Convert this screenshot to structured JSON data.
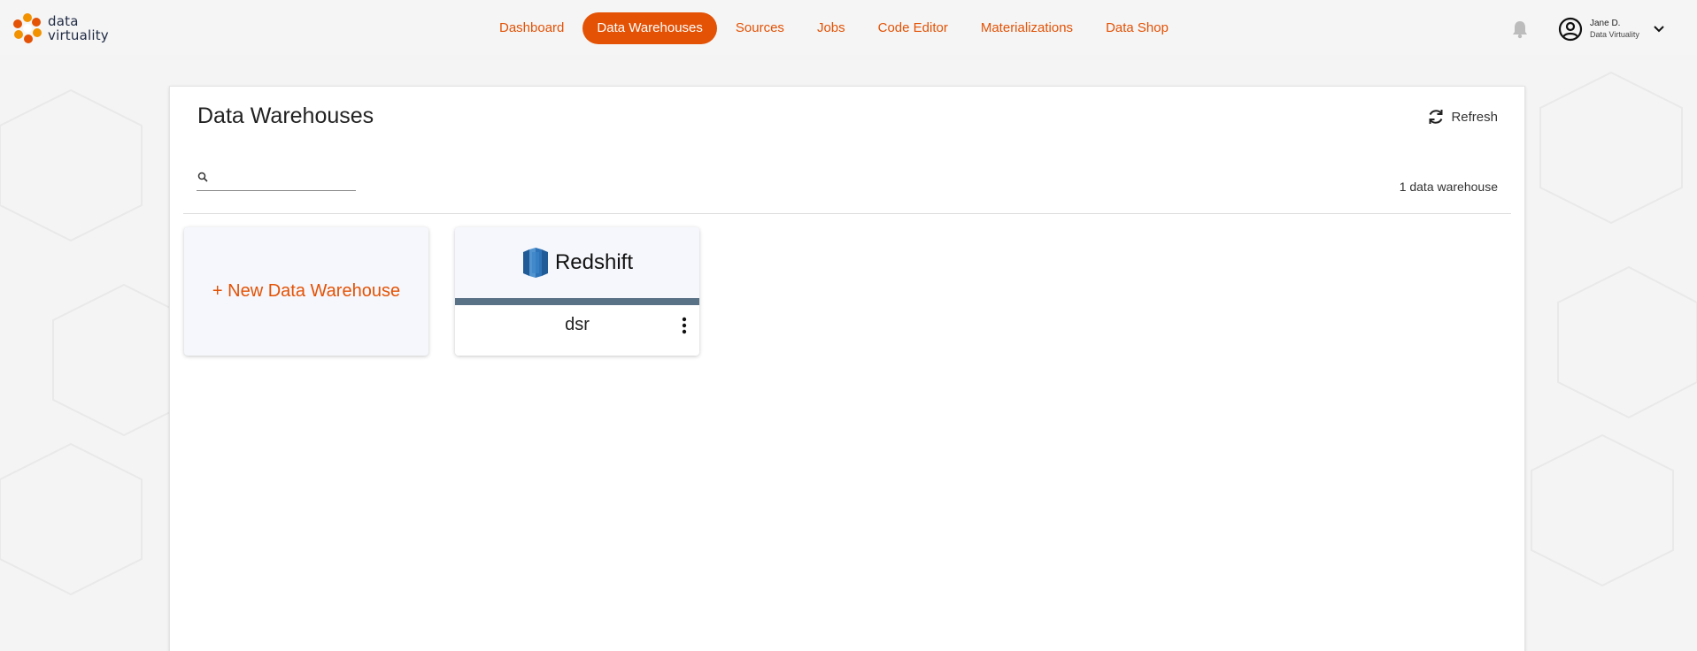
{
  "app": {
    "logo_line1": "data",
    "logo_line2": "virtuality",
    "brand_color": "#e35205"
  },
  "nav": {
    "items": [
      {
        "label": "Dashboard",
        "active": false
      },
      {
        "label": "Data Warehouses",
        "active": true
      },
      {
        "label": "Sources",
        "active": false
      },
      {
        "label": "Jobs",
        "active": false
      },
      {
        "label": "Code Editor",
        "active": false
      },
      {
        "label": "Materializations",
        "active": false
      },
      {
        "label": "Data Shop",
        "active": false
      }
    ]
  },
  "user": {
    "name": "Jane D.",
    "org": "Data Virtuality"
  },
  "page": {
    "title": "Data Warehouses",
    "refresh_label": "Refresh",
    "search_value": "",
    "count_label": "1 data warehouse"
  },
  "tiles": {
    "new_label": "+ New Data Warehouse",
    "warehouses": [
      {
        "type_label": "Redshift",
        "name": "dsr",
        "bar_color": "#5a7286"
      }
    ]
  },
  "icons": [
    "bell-icon",
    "user-avatar-icon",
    "chevron-down-icon",
    "refresh-icon",
    "search-icon",
    "redshift-logo-icon",
    "kebab-menu-icon"
  ]
}
